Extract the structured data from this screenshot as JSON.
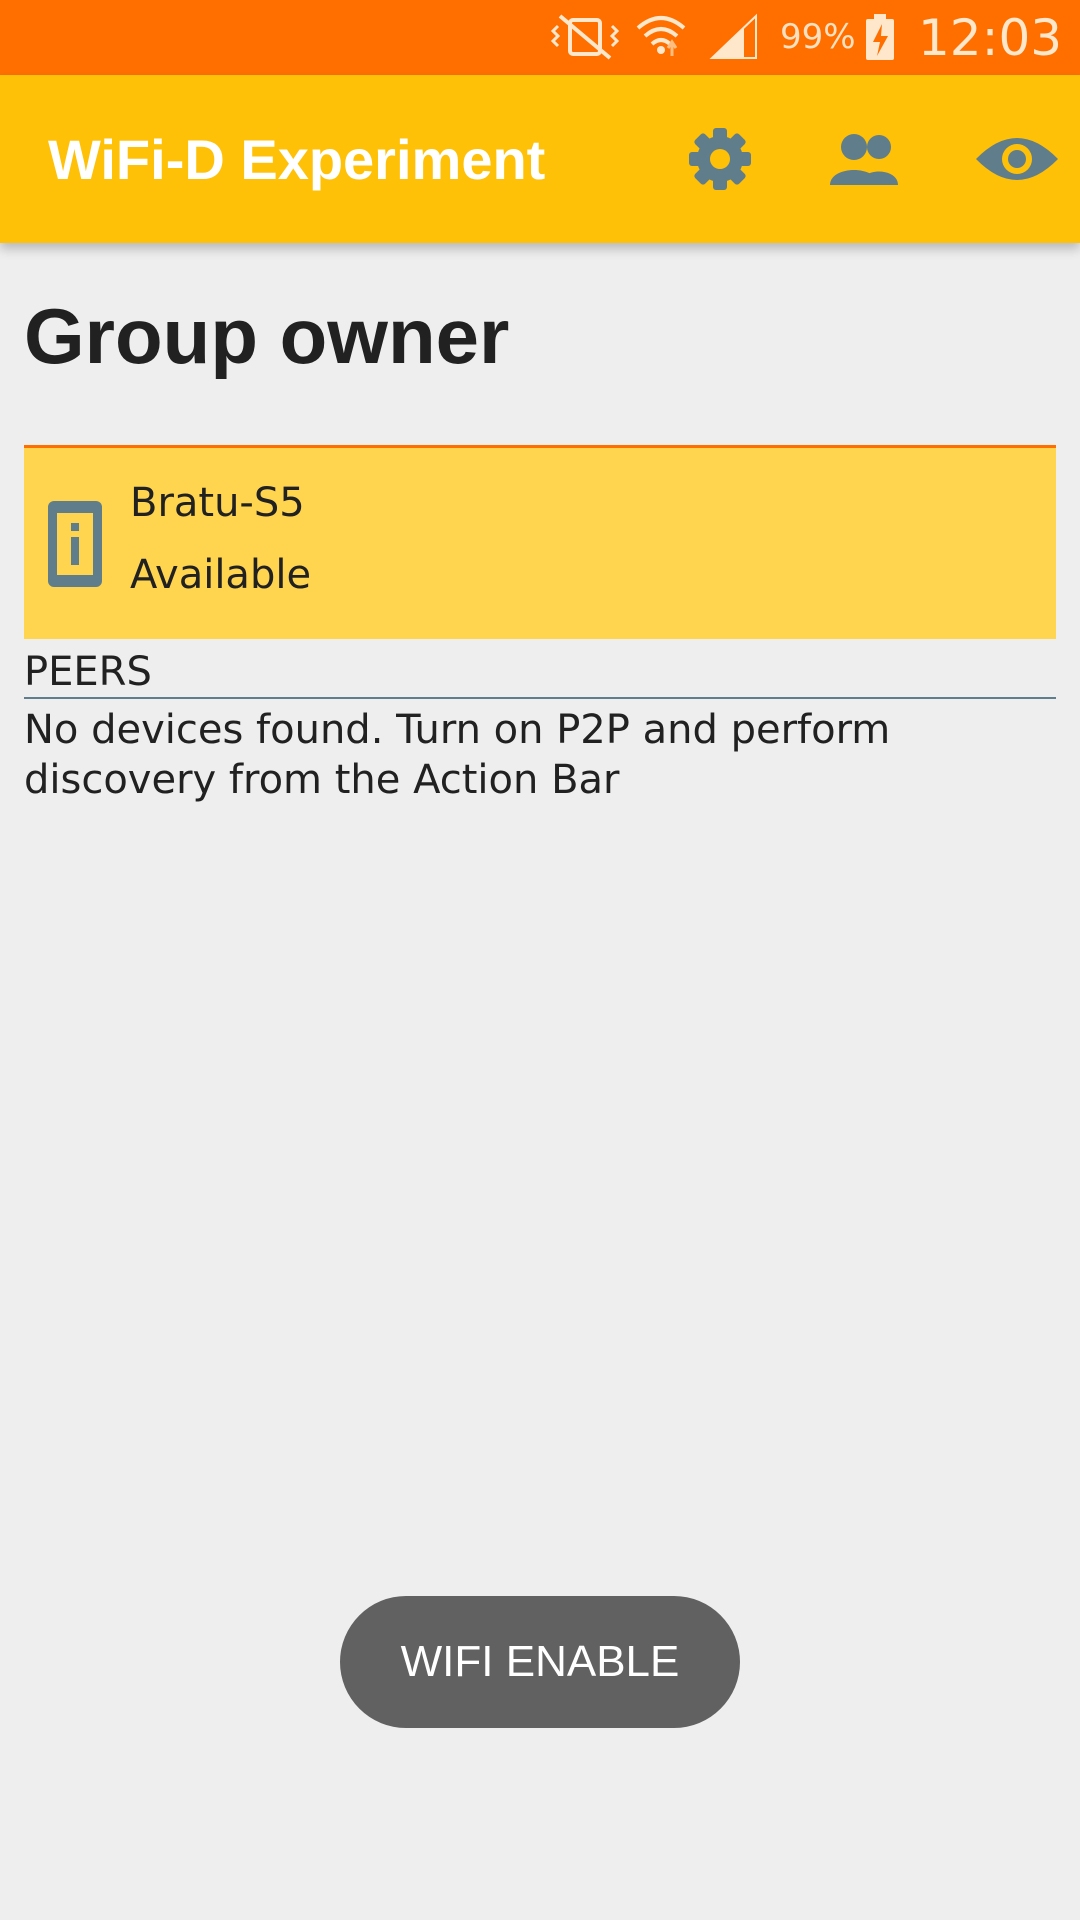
{
  "status_bar": {
    "battery_percent": "99%",
    "clock": "12:03",
    "icons": [
      "mute-vibrate-icon",
      "wifi-icon",
      "cell-signal-icon",
      "battery-charging-icon"
    ]
  },
  "app_bar": {
    "title": "WiFi-D Experiment",
    "actions": [
      "settings-icon",
      "group-icon",
      "visibility-icon"
    ],
    "icon_color": "#607d8b"
  },
  "main": {
    "title": "Group owner",
    "this_device": {
      "name": "Bratu-S5",
      "status": "Available",
      "icon": "device-info-icon"
    },
    "peers": {
      "header": "PEERS",
      "empty_message": "No devices found. Turn on P2P and perform discovery from the Action Bar"
    }
  },
  "toast": {
    "text": "WIFI ENABLE"
  },
  "colors": {
    "status_bar": "#ff6f00",
    "app_bar": "#ffc107",
    "card_bg": "#ffd54f",
    "background": "#eeeeee",
    "toast_bg": "#616161"
  }
}
